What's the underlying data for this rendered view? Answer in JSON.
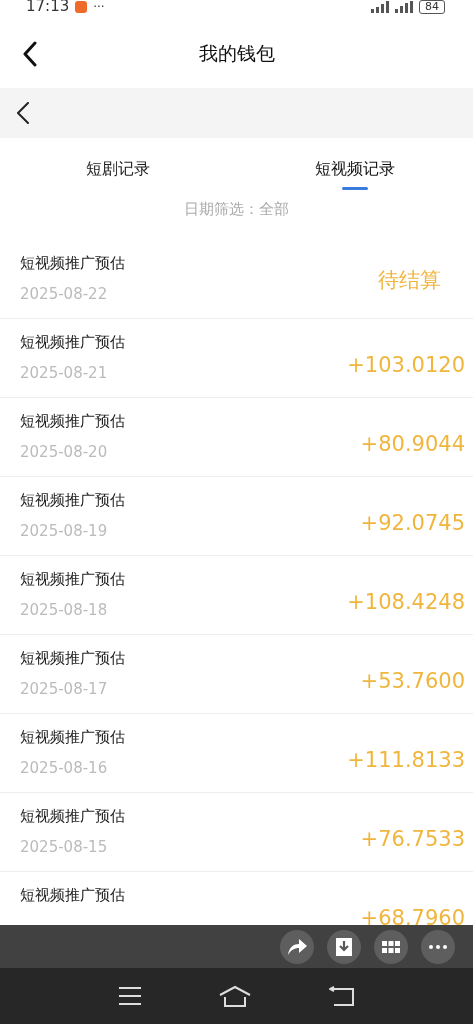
{
  "status_bar": {
    "time": "17:13",
    "more": "···",
    "battery": "84"
  },
  "header": {
    "title": "我的钱包"
  },
  "tabs": [
    {
      "label": "短剧记录",
      "selected": false
    },
    {
      "label": "短视频记录",
      "selected": true
    }
  ],
  "filter": {
    "label": "日期筛选：全部"
  },
  "records": [
    {
      "title": "短视频推广预估",
      "date": "2025-08-22",
      "amount": "待结算"
    },
    {
      "title": "短视频推广预估",
      "date": "2025-08-21",
      "amount": "+103.0120"
    },
    {
      "title": "短视频推广预估",
      "date": "2025-08-20",
      "amount": "+80.9044"
    },
    {
      "title": "短视频推广预估",
      "date": "2025-08-19",
      "amount": "+92.0745"
    },
    {
      "title": "短视频推广预估",
      "date": "2025-08-18",
      "amount": "+108.4248"
    },
    {
      "title": "短视频推广预估",
      "date": "2025-08-17",
      "amount": "+53.7600"
    },
    {
      "title": "短视频推广预估",
      "date": "2025-08-16",
      "amount": "+111.8133"
    },
    {
      "title": "短视频推广预估",
      "date": "2025-08-15",
      "amount": "+76.7533"
    },
    {
      "title": "短视频推广预估",
      "amount": "+68.7960"
    }
  ]
}
